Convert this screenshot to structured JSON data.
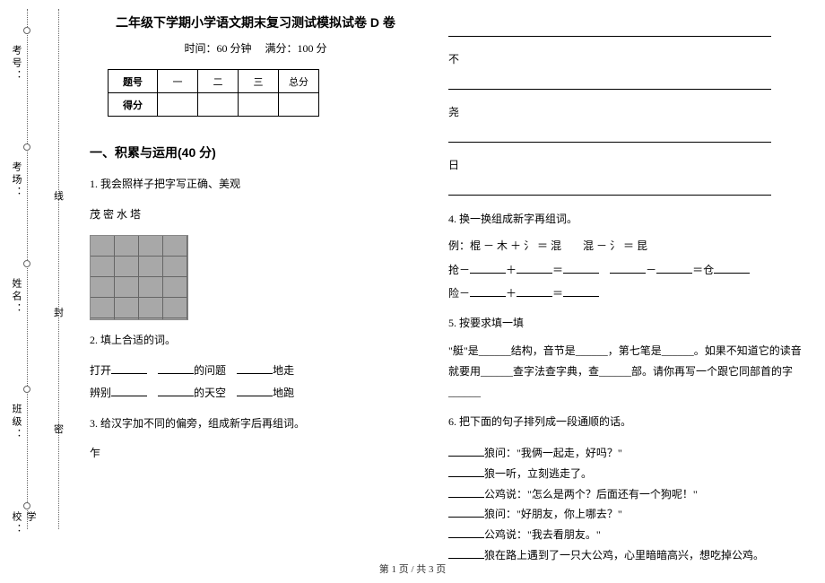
{
  "binding": {
    "labels": {
      "school": "学校：",
      "class": "班级：",
      "name": "姓名：",
      "room": "考场：",
      "id": "考号："
    },
    "seals": {
      "mi": "密",
      "feng": "封",
      "xian": "线"
    }
  },
  "title": "二年级下学期小学语文期末复习测试模拟试卷 D 卷",
  "subtitle_time": "时间：60 分钟",
  "subtitle_full": "满分：100 分",
  "score_table": {
    "row_header_1": "题号",
    "row_header_2": "得分",
    "cols": [
      "一",
      "二",
      "三",
      "总分"
    ]
  },
  "section1_title": "一、积累与运用(40 分)",
  "q1": {
    "text": "1. 我会照样子把字写正确、美观",
    "sample": "茂 密 水 塔"
  },
  "q2": {
    "text": "2. 填上合适的词。",
    "line1_a": "打开",
    "line1_b": "的问题",
    "line1_c": "地走",
    "line2_a": "辨别",
    "line2_b": "的天空",
    "line2_c": "地跑"
  },
  "q3": {
    "text": "3. 给汉字加不同的偏旁，组成新字后再组词。",
    "chars": {
      "c1": "乍",
      "c2": "不",
      "c3": "尧",
      "c4": "日"
    }
  },
  "q4": {
    "text": "4. 换一换组成新字再组词。",
    "example": "例：棍 － 木 ＋ 氵 ＝ 混　　混 － 氵 ＝ 昆",
    "line_a": "抢－",
    "line_b": "险－",
    "tail": "＝仓"
  },
  "q5": {
    "text": "5. 按要求填一填",
    "body": "\"艇\"是______结构，音节是______，第七笔是______。如果不知道它的读音就要用______查字法查字典，查______部。请你再写一个跟它同部首的字______"
  },
  "q6": {
    "text": "6. 把下面的句子排列成一段通顺的话。",
    "lines": [
      "狼问：\"我俩一起走，好吗？\"",
      "狼一听，立刻逃走了。",
      "公鸡说：\"怎么是两个？后面还有一个狗呢！\"",
      "狼问：\"好朋友，你上哪去？\"",
      "公鸡说：\"我去看朋友。\"",
      "狼在路上遇到了一只大公鸡，心里暗暗高兴，想吃掉公鸡。"
    ]
  },
  "footer": "第 1 页 / 共 3 页"
}
